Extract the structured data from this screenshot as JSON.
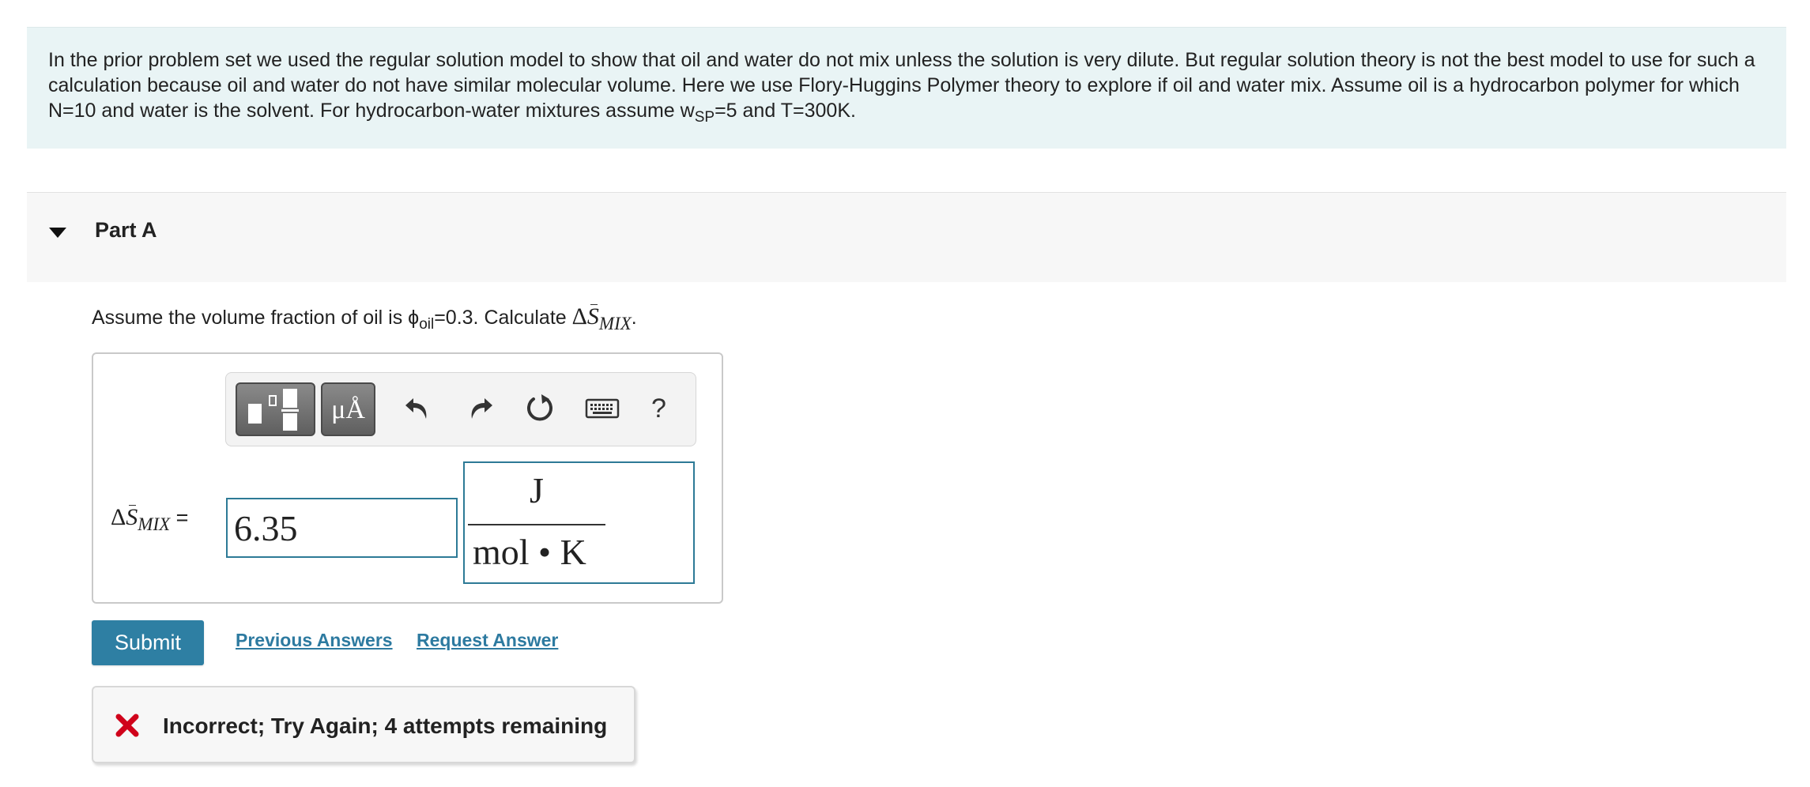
{
  "intro": {
    "text_main": "In  the prior problem set we used the regular solution model to show that oil and water do not mix unless the solution is very dilute. But regular solution theory is not the best model to use for such a calculation because oil and water do not have similar molecular volume. Here we use Flory-Huggins Polymer theory to explore if oil and water mix. Assume oil is a hydrocarbon polymer for which N=10 and water is the solvent. For hydrocarbon-water mixtures assume w",
    "sub_sp": "SP",
    "text_end": "=5 and T=300K."
  },
  "part": {
    "title": "Part A"
  },
  "question": {
    "prefix": "Assume the volume fraction of oil is ϕ",
    "sub_oil": "oil",
    "middle": "=0.3. Calculate ",
    "delta": "Δ",
    "s": "S",
    "mix": "MIX",
    "end": "."
  },
  "toolbar": {
    "units_label": "μÅ",
    "help_label": "?",
    "icons": [
      "templates-icon",
      "units-icon",
      "undo-icon",
      "redo-icon",
      "reset-icon",
      "keyboard-icon",
      "help-icon"
    ]
  },
  "answer": {
    "lhs_delta": "Δ",
    "lhs_s": "S",
    "lhs_mix": "MIX",
    "lhs_eq": " =",
    "value": "6.35",
    "unit_numerator": "J",
    "unit_denominator": "mol • K"
  },
  "actions": {
    "submit_label": "Submit",
    "previous_answers": "Previous Answers",
    "request_answer": "Request Answer"
  },
  "feedback": {
    "text": "Incorrect; Try Again; 4 attempts remaining",
    "color": "#d0021b"
  },
  "colors": {
    "accent": "#2e7fa3",
    "intro_bg": "#e9f4f5",
    "input_border": "#2d7a96"
  }
}
